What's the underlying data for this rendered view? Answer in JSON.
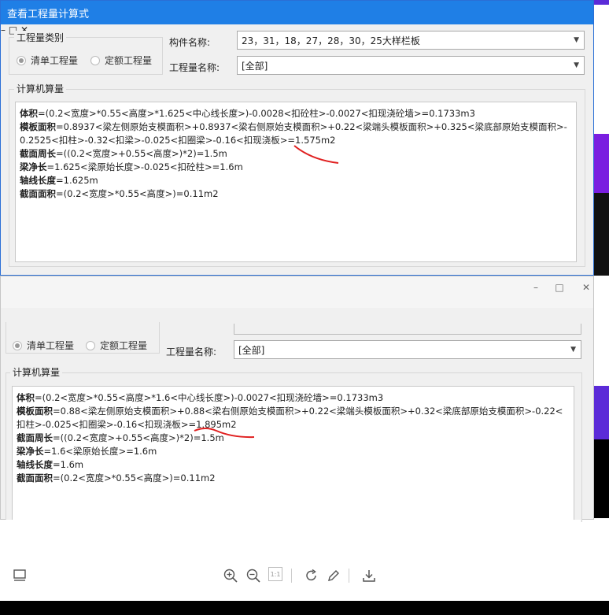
{
  "window1": {
    "title": "查看工程量计算式",
    "controls": {
      "minimize": "–",
      "maximize": "□",
      "close": "✕"
    },
    "quantity_category": {
      "legend": "工程量类别",
      "options": [
        {
          "label": "清单工程量",
          "selected": true
        },
        {
          "label": "定额工程量",
          "selected": false
        }
      ]
    },
    "component_name": {
      "label": "构件名称:",
      "value": "23，31，18，27，28，30，25大样栏板"
    },
    "quantity_name": {
      "label": "工程量名称:",
      "value": "[全部]"
    },
    "calc": {
      "legend": "计算机算量",
      "lines": [
        {
          "key": "体积",
          "expr": "=(0.2<宽度>*0.55<高度>*1.625<中心线长度>)-0.0028<扣砼柱>-0.0027<扣现浇砼墙>=0.1733m3"
        },
        {
          "key": "模板面积",
          "expr": "=0.8937<梁左侧原始支模面积>+0.8937<梁右侧原始支模面积>+0.22<梁端头模板面积>+0.325<梁底部原始支模面积>-0.2525<扣柱>-0.32<扣梁>-0.025<扣圈梁>-0.16<扣现浇板>=1.575m2"
        },
        {
          "key": "截面周长",
          "expr": "=((0.2<宽度>+0.55<高度>)*2)=1.5m"
        },
        {
          "key": "梁净长",
          "expr": "=1.625<梁原始长度>-0.025<扣砼柱>=1.6m"
        },
        {
          "key": "轴线长度",
          "expr": "=1.625m"
        },
        {
          "key": "截面面积",
          "expr": "=(0.2<宽度>*0.55<高度>)=0.11m2"
        }
      ]
    }
  },
  "window2": {
    "controls": {
      "minimize": "–",
      "maximize": "□",
      "close": "✕"
    },
    "quantity_category": {
      "options": [
        {
          "label": "清单工程量",
          "selected": true
        },
        {
          "label": "定额工程量",
          "selected": false
        }
      ]
    },
    "quantity_name": {
      "label": "工程量名称:",
      "value": "[全部]"
    },
    "calc": {
      "legend": "计算机算量",
      "lines": [
        {
          "key": "体积",
          "expr": "=(0.2<宽度>*0.55<高度>*1.6<中心线长度>)-0.0027<扣现浇砼墙>=0.1733m3"
        },
        {
          "key": "模板面积",
          "expr": "=0.88<梁左侧原始支模面积>+0.88<梁右侧原始支模面积>+0.22<梁端头模板面积>+0.32<梁底部原始支模面积>-0.22<扣柱>-0.025<扣圈梁>-0.16<扣现浇板>=1.895m2"
        },
        {
          "key": "截面周长",
          "expr": "=((0.2<宽度>+0.55<高度>)*2)=1.5m"
        },
        {
          "key": "梁净长",
          "expr": "=1.6<梁原始长度>=1.6m"
        },
        {
          "key": "轴线长度",
          "expr": "=1.6m"
        },
        {
          "key": "截面面积",
          "expr": "=(0.2<宽度>*0.55<高度>)=0.11m2"
        }
      ]
    }
  },
  "toolbar": {
    "icons": [
      "layout-icon",
      "zoom-in-icon",
      "zoom-out-icon",
      "actual-size-icon",
      "rotate-icon",
      "edit-icon",
      "download-icon"
    ],
    "actual_size_label": "1:1"
  },
  "colors": {
    "titlebar": "#1f7fe6",
    "annotation": "#e02020"
  }
}
